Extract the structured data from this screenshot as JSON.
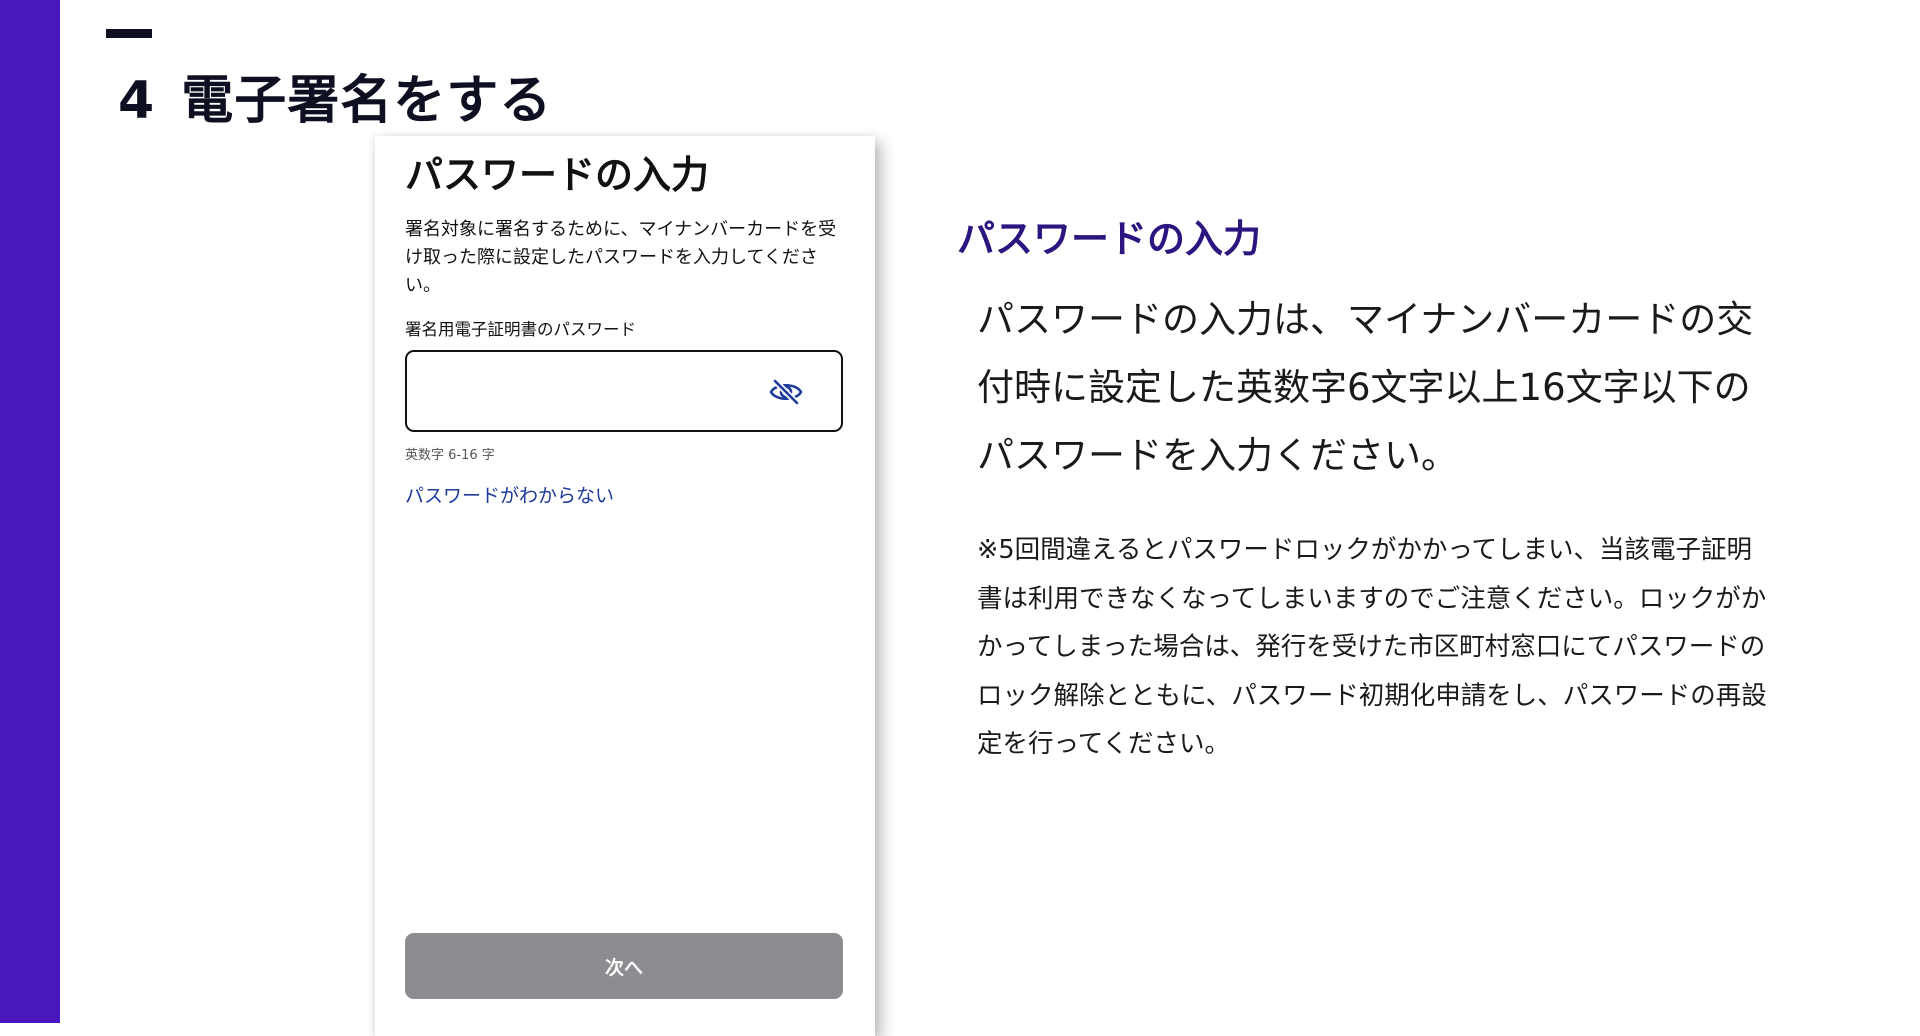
{
  "slide": {
    "number": "4",
    "title": "電子署名をする"
  },
  "phone": {
    "screen_title": "パスワードの入力",
    "description": "署名対象に署名するために、マイナンバーカードを受け取った際に設定したパスワードを入力してください。",
    "field_label": "署名用電子証明書のパスワード",
    "input_value": "",
    "hint": "英数字 6-16 字",
    "forgot_link": "パスワードがわからない",
    "next_button": "次へ",
    "eye_icon": "eye-slash-icon"
  },
  "explanation": {
    "heading": "パスワードの入力",
    "main_text": "パスワードの入力は、マイナンバーカードの交付時に設定した英数字6文字以上16文字以下のパスワードを入力ください。",
    "note": "※5回間違えるとパスワードロックがかかってしまい、当該電子証明書は利用できなくなってしまいますのでご注意ください。ロックがかかってしまった場合は、発行を受けた市区町村窓口にてパスワードのロック解除とともに、パスワード初期化申請をし、パスワードの再設定を行ってください。"
  },
  "colors": {
    "accent_bar": "#4a17bf",
    "heading": "#2d1580",
    "link": "#1f3b9b",
    "disabled_button": "#8c8c91"
  }
}
